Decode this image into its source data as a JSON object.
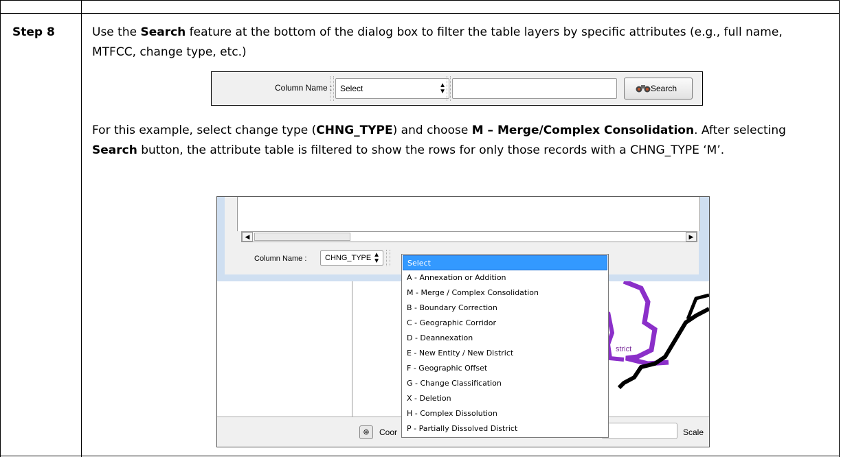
{
  "step": {
    "label": "Step 8"
  },
  "paragraph1": {
    "t1": "Use the ",
    "b1": "Search",
    "t2": " feature at the bottom of the dialog box to filter the table layers by specific attributes (e.g., full name, MTFCC, change type, etc.)"
  },
  "search_bar": {
    "column_label": "Column Name :",
    "select_value": "Select",
    "input_value": "",
    "search_button": "Search"
  },
  "paragraph2": {
    "t1": "For this example, select change type (",
    "b1": "CHNG_TYPE",
    "t2": ") and choose ",
    "b2": "M – Merge/Complex Consolidation",
    "t3": ". After selecting ",
    "b3": "Search",
    "t4": " button, the attribute table is filtered to show the rows for only those records with a CHNG_TYPE ‘M’."
  },
  "dialog": {
    "column_label": "Column Name :",
    "column_value": "CHNG_TYPE",
    "dropdown_options": [
      "Select",
      "A - Annexation or Addition",
      "M - Merge / Complex Consolidation",
      "B - Boundary Correction",
      "C - Geographic Corridor",
      "D - Deannexation",
      "E - New Entity / New District",
      "F - Geographic Offset",
      "G - Change Classification",
      "X - Deletion",
      "H - Complex Dissolution",
      "P - Partially Dissolved District"
    ],
    "selected_option": "Select",
    "map_label": "strict",
    "status_coord_label": "Coor",
    "status_scale_label": "Scale"
  },
  "colors": {
    "selection": "#3399ff",
    "district_line": "#8b2fc9",
    "boundary_line": "#000000"
  }
}
